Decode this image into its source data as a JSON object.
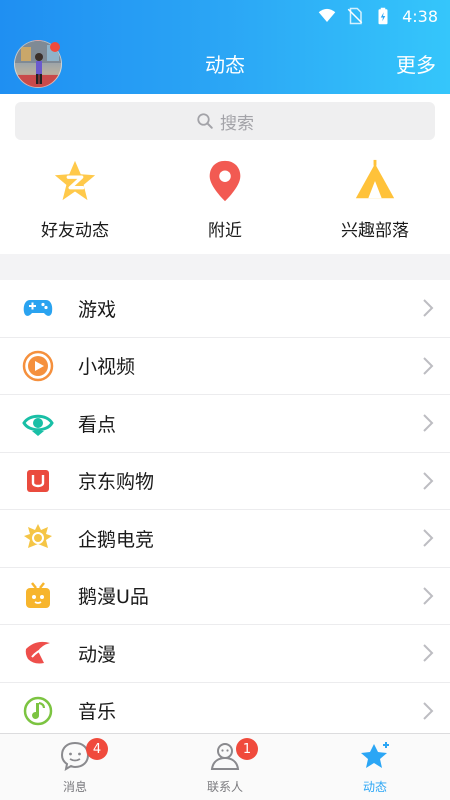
{
  "status_bar": {
    "time": "4:38"
  },
  "header": {
    "title": "动态",
    "more_label": "更多"
  },
  "search": {
    "placeholder": "搜索"
  },
  "quick_actions": [
    {
      "label": "好友动态",
      "icon": "qzone-star-icon",
      "color": "#ffc94a"
    },
    {
      "label": "附近",
      "icon": "location-pin-icon",
      "color": "#f25a52"
    },
    {
      "label": "兴趣部落",
      "icon": "tribe-tent-icon",
      "color": "#ffc23a"
    }
  ],
  "menu": [
    {
      "label": "游戏",
      "icon": "gamepad-icon",
      "color": "#2aa3f0"
    },
    {
      "label": "小视频",
      "icon": "play-circle-icon",
      "color": "#f5903d"
    },
    {
      "label": "看点",
      "icon": "eye-icon",
      "color": "#19bfa6"
    },
    {
      "label": "京东购物",
      "icon": "jd-shopping-icon",
      "color": "#ea4b3e"
    },
    {
      "label": "企鹅电竞",
      "icon": "esports-crown-icon",
      "color": "#f5c545"
    },
    {
      "label": "鹅漫U品",
      "icon": "tv-box-icon",
      "color": "#f7b52d"
    },
    {
      "label": "动漫",
      "icon": "comic-icon",
      "color": "#ee4f4b"
    },
    {
      "label": "音乐",
      "icon": "music-note-icon",
      "color": "#7cc441"
    }
  ],
  "tabbar": {
    "tabs": [
      {
        "label": "消息",
        "icon": "message-icon",
        "badge": "4"
      },
      {
        "label": "联系人",
        "icon": "contacts-icon",
        "badge": "1"
      },
      {
        "label": "动态",
        "icon": "star-icon",
        "badge": ""
      }
    ],
    "active_color": "#2ba6f5"
  }
}
